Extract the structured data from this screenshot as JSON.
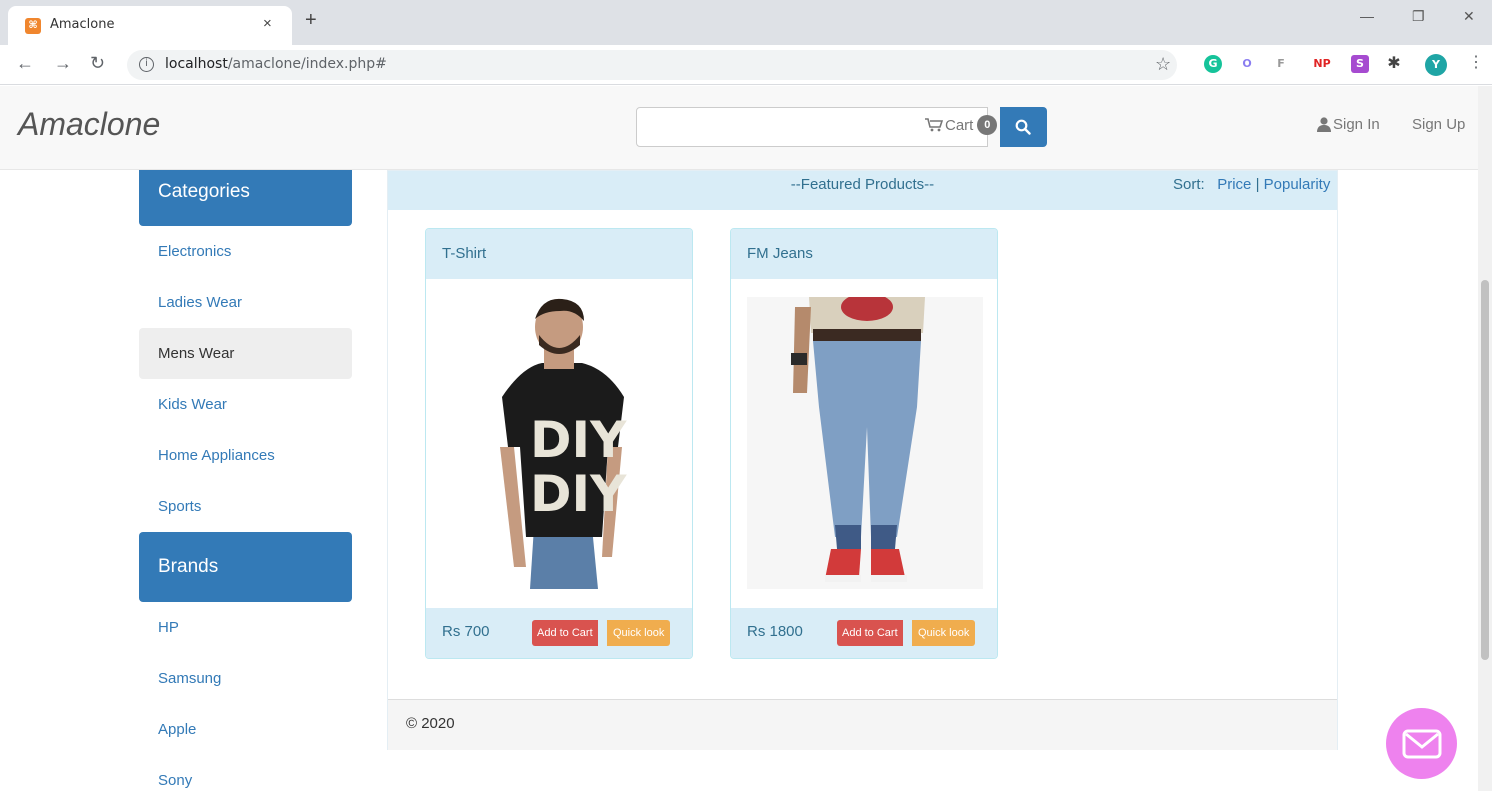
{
  "browser": {
    "tab_title": "Amaclone",
    "tab_close": "×",
    "new_tab": "+",
    "url_host": "localhost",
    "url_path": "/amaclone/index.php#",
    "extensions": [
      "G",
      "O",
      "F",
      "NP",
      "S"
    ],
    "profile_initial": "Y"
  },
  "navbar": {
    "brand": "Amaclone",
    "cart_label": "Cart",
    "cart_count": "0",
    "signin_label": "Sign In",
    "signup_label": "Sign Up"
  },
  "sidebar": {
    "categories_title": "Categories",
    "categories": [
      {
        "label": "Electronics"
      },
      {
        "label": "Ladies Wear"
      },
      {
        "label": "Mens Wear"
      },
      {
        "label": "Kids Wear"
      },
      {
        "label": "Home Appliances"
      },
      {
        "label": "Sports"
      }
    ],
    "brands_title": "Brands",
    "brands": [
      {
        "label": "HP"
      },
      {
        "label": "Samsung"
      },
      {
        "label": "Apple"
      },
      {
        "label": "Sony"
      }
    ]
  },
  "main": {
    "panel_title": "--Featured Products--",
    "sort_label": "Sort:",
    "sort_price": "Price",
    "sort_separator": "|",
    "sort_popularity": "Popularity",
    "products": [
      {
        "name": "T-Shirt",
        "price": "Rs 700",
        "add_to_cart": "Add to Cart",
        "quick_look": "Quick look"
      },
      {
        "name": "FM Jeans",
        "price": "Rs 1800",
        "add_to_cart": "Add to Cart",
        "quick_look": "Quick look"
      }
    ],
    "footer": "© 2020"
  },
  "colors": {
    "primary": "#337ab7",
    "info_bg": "#d9edf7",
    "danger": "#d9534f",
    "warning": "#f0ad4e",
    "chat_fab": "#ee82ee"
  }
}
